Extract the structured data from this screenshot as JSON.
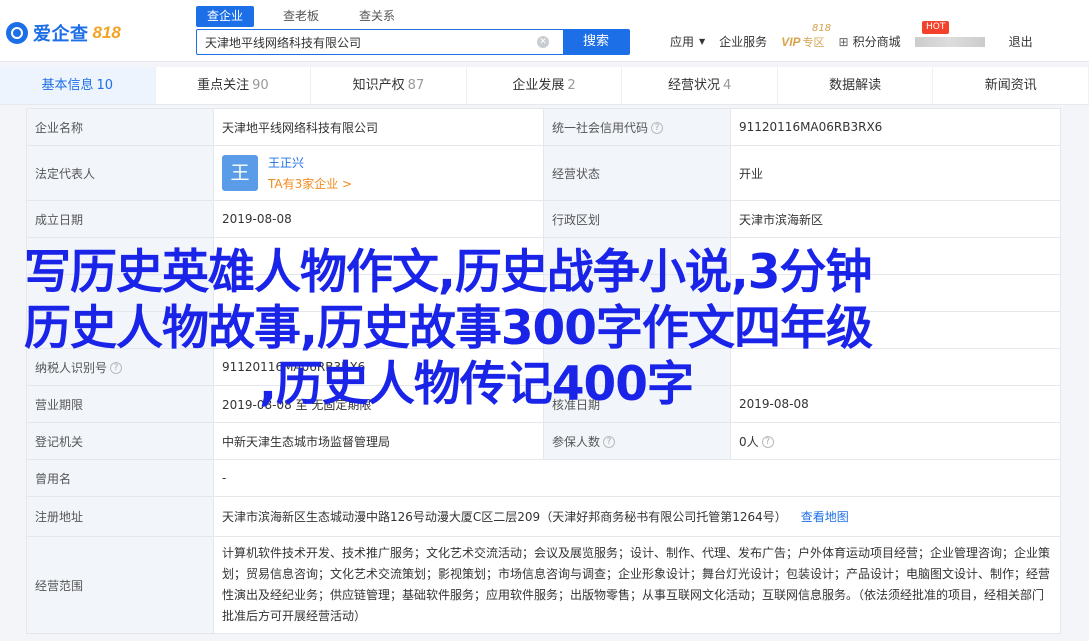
{
  "header": {
    "logo_text": "爱企查",
    "logo_num": "818",
    "search_tabs": [
      "查企业",
      "查老板",
      "查关系"
    ],
    "search_value": "天津地平线网络科技有限公司",
    "search_button": "搜索",
    "nav": {
      "app": "应用",
      "enterprise_service": "企业服务",
      "vip": "VIP",
      "vip_sub": "专区",
      "badge": "818",
      "points": "积分商城",
      "hot": "HOT",
      "logout": "退出"
    }
  },
  "subtabs": [
    {
      "label": "基本信息",
      "count": "10"
    },
    {
      "label": "重点关注",
      "count": "90"
    },
    {
      "label": "知识产权",
      "count": "87"
    },
    {
      "label": "企业发展",
      "count": "2"
    },
    {
      "label": "经营状况",
      "count": "4"
    },
    {
      "label": "数据解读",
      "count": ""
    },
    {
      "label": "新闻资讯",
      "count": ""
    }
  ],
  "info": {
    "company_name_label": "企业名称",
    "company_name": "天津地平线网络科技有限公司",
    "credit_code_label": "统一社会信用代码",
    "credit_code": "91120116MA06RB3RX6",
    "legal_rep_label": "法定代表人",
    "legal_rep_avatar": "王",
    "legal_rep_name": "王正兴",
    "legal_rep_sub": "TA有3家企业 >",
    "status_label": "经营状态",
    "status": "开业",
    "founded_label": "成立日期",
    "founded": "2019-08-08",
    "region_label": "行政区划",
    "region": "天津市滨海新区",
    "taxpayer_label": "纳税人识别号",
    "taxpayer": "91120116MA06RB3RX6",
    "term_label": "营业期限",
    "term": "2019-08-08 至 无固定期限",
    "approval_label": "核准日期",
    "approval": "2019-08-08",
    "registrar_label": "登记机关",
    "registrar": "中新天津生态城市场监督管理局",
    "insured_label": "参保人数",
    "insured": "0人",
    "former_name_label": "曾用名",
    "former_name": "-",
    "address_label": "注册地址",
    "address": "天津市滨海新区生态城动漫中路126号动漫大厦C区二层209（天津好邦商务秘书有限公司托管第1264号）",
    "map_link": "查看地图",
    "scope_label": "经营范围",
    "scope": "计算机软件技术开发、技术推广服务；文化艺术交流活动；会议及展览服务；设计、制作、代理、发布广告；户外体育运动项目经营；企业管理咨询；企业策划；贸易信息咨询；文化艺术交流策划；影视策划；市场信息咨询与调查；企业形象设计；舞台灯光设计；包装设计；产品设计；电脑图文设计、制作；经营性演出及经纪业务；供应链管理；基础软件服务；应用软件服务；出版物零售；从事互联网文化活动；互联网信息服务。（依法须经批准的项目，经相关部门批准后方可开展经营活动）"
  },
  "overlay": {
    "line1": "写历史英雄人物作文,历史战争小说,3分钟",
    "line2": "历史人物故事,历史故事300字作文四年级",
    "line3": ",历史人物传记400字"
  },
  "colors": {
    "accent": "#1d6fe8",
    "overlay": "#1a24e8",
    "hot": "#f5412b"
  }
}
